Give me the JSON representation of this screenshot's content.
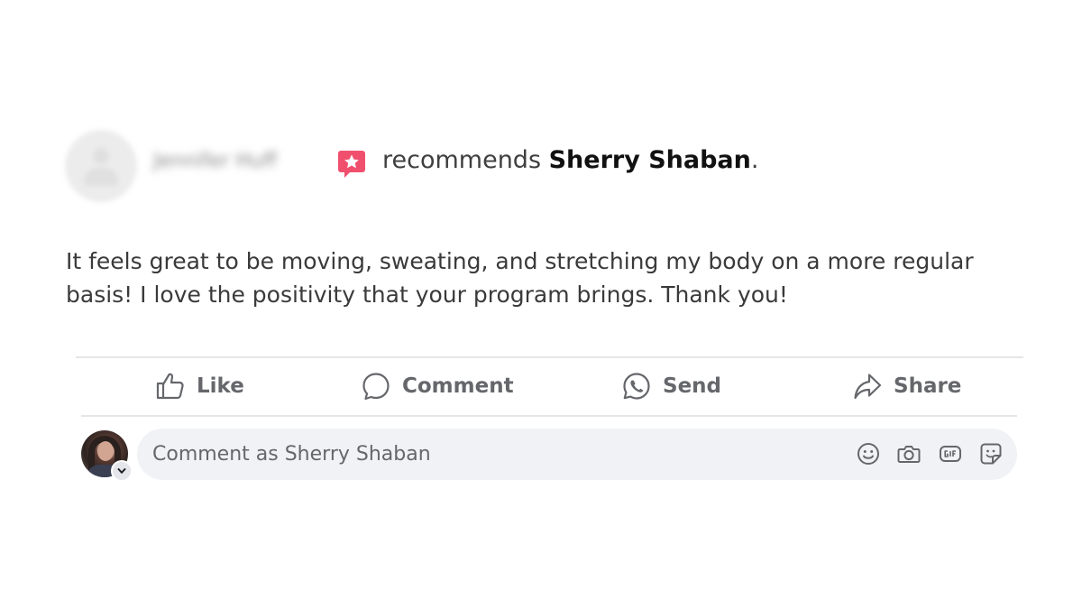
{
  "post": {
    "author_name": "Jennifer Huff",
    "recommend_verb": "recommends",
    "page_name": "Sherry Shaban",
    "punctuation": ".",
    "review_text": "It feels great to be moving, sweating, and stretching my body on a more regular basis! I love the positivity that your program brings. Thank you!"
  },
  "actions": {
    "like": "Like",
    "comment": "Comment",
    "send": "Send",
    "share": "Share"
  },
  "composer": {
    "placeholder": "Comment as Sherry Shaban",
    "value": "",
    "tools": [
      "emoji-icon",
      "camera-icon",
      "gif-icon",
      "sticker-icon"
    ]
  },
  "colors": {
    "recommend_badge": "#f0506e",
    "action_text": "#65676b",
    "composer_bg": "#f0f2f5"
  }
}
